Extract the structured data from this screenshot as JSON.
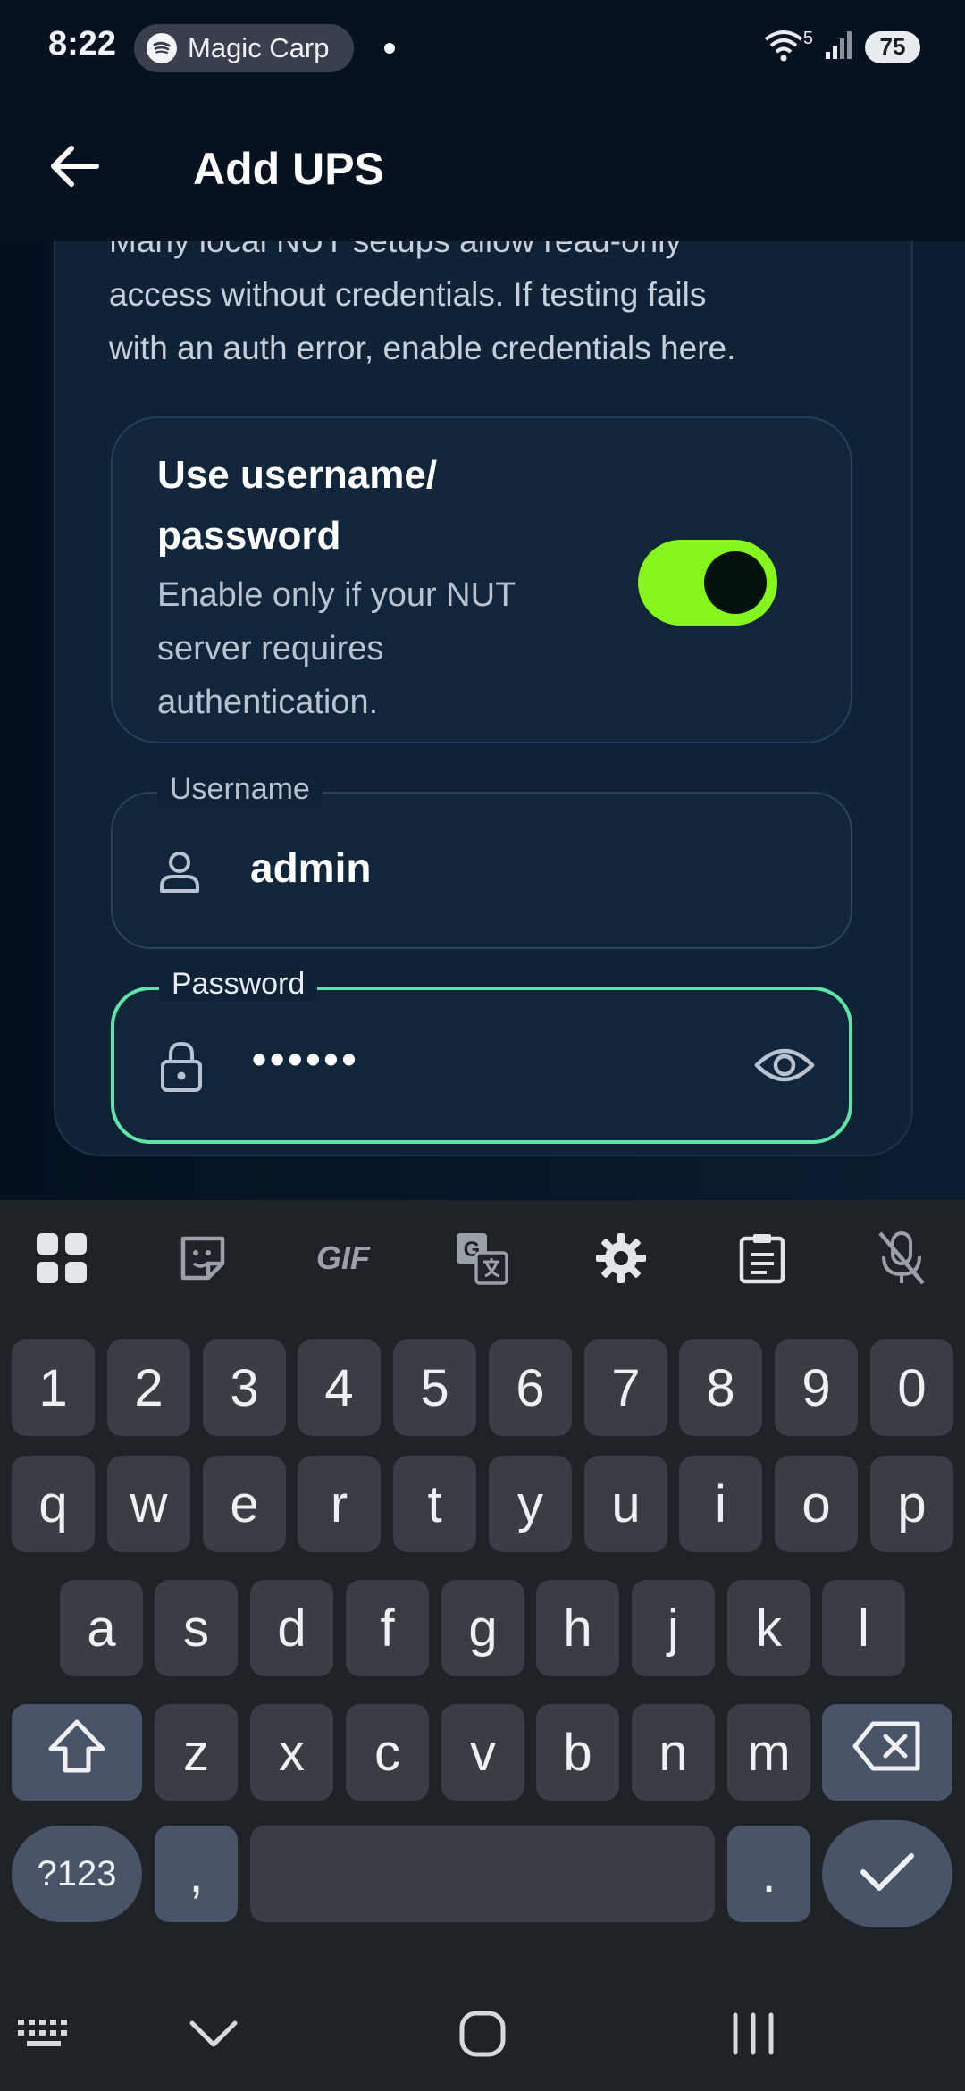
{
  "status_bar": {
    "time": "8:22",
    "media_pill": "Magic Carp",
    "battery": "75",
    "signal_label": "5"
  },
  "app_bar": {
    "title": "Add UPS",
    "back_icon": "arrow-left-icon"
  },
  "credentials": {
    "desc_line1": "Many local NUT setups allow read-only",
    "desc_line2": "access without credentials. If testing fails",
    "desc_line3": "with an auth error, enable credentials here.",
    "toggle_title_line1": "Use username/",
    "toggle_title_line2": "password",
    "toggle_sub_line1": "Enable only if your NUT",
    "toggle_sub_line2": "server requires",
    "toggle_sub_line3": "authentication.",
    "toggle_on": true,
    "toggle_color": "#84f51d"
  },
  "username_field": {
    "label": "Username",
    "value": "admin",
    "icon": "person-icon"
  },
  "password_field": {
    "label": "Password",
    "value": "••••••",
    "icon": "lock-icon",
    "toggle_icon": "eye-icon",
    "focus_color": "#5ce6a6"
  },
  "keyboard": {
    "tools": [
      "apps-icon",
      "sticker-icon",
      "GIF",
      "translate-icon",
      "gear-icon",
      "clipboard-icon",
      "mic-off-icon"
    ],
    "gif_label": "GIF",
    "row_numbers": [
      "1",
      "2",
      "3",
      "4",
      "5",
      "6",
      "7",
      "8",
      "9",
      "0"
    ],
    "row1": [
      "q",
      "w",
      "e",
      "r",
      "t",
      "y",
      "u",
      "i",
      "o",
      "p"
    ],
    "row2": [
      "a",
      "s",
      "d",
      "f",
      "g",
      "h",
      "j",
      "k",
      "l"
    ],
    "row3": [
      "z",
      "x",
      "c",
      "v",
      "b",
      "n",
      "m"
    ],
    "symbols_label": "?123",
    "comma_label": ",",
    "period_label": "."
  },
  "nav_bar": {
    "buttons": [
      "keyboard-icon",
      "chevron-down-icon",
      "home-icon",
      "recents-icon"
    ]
  }
}
